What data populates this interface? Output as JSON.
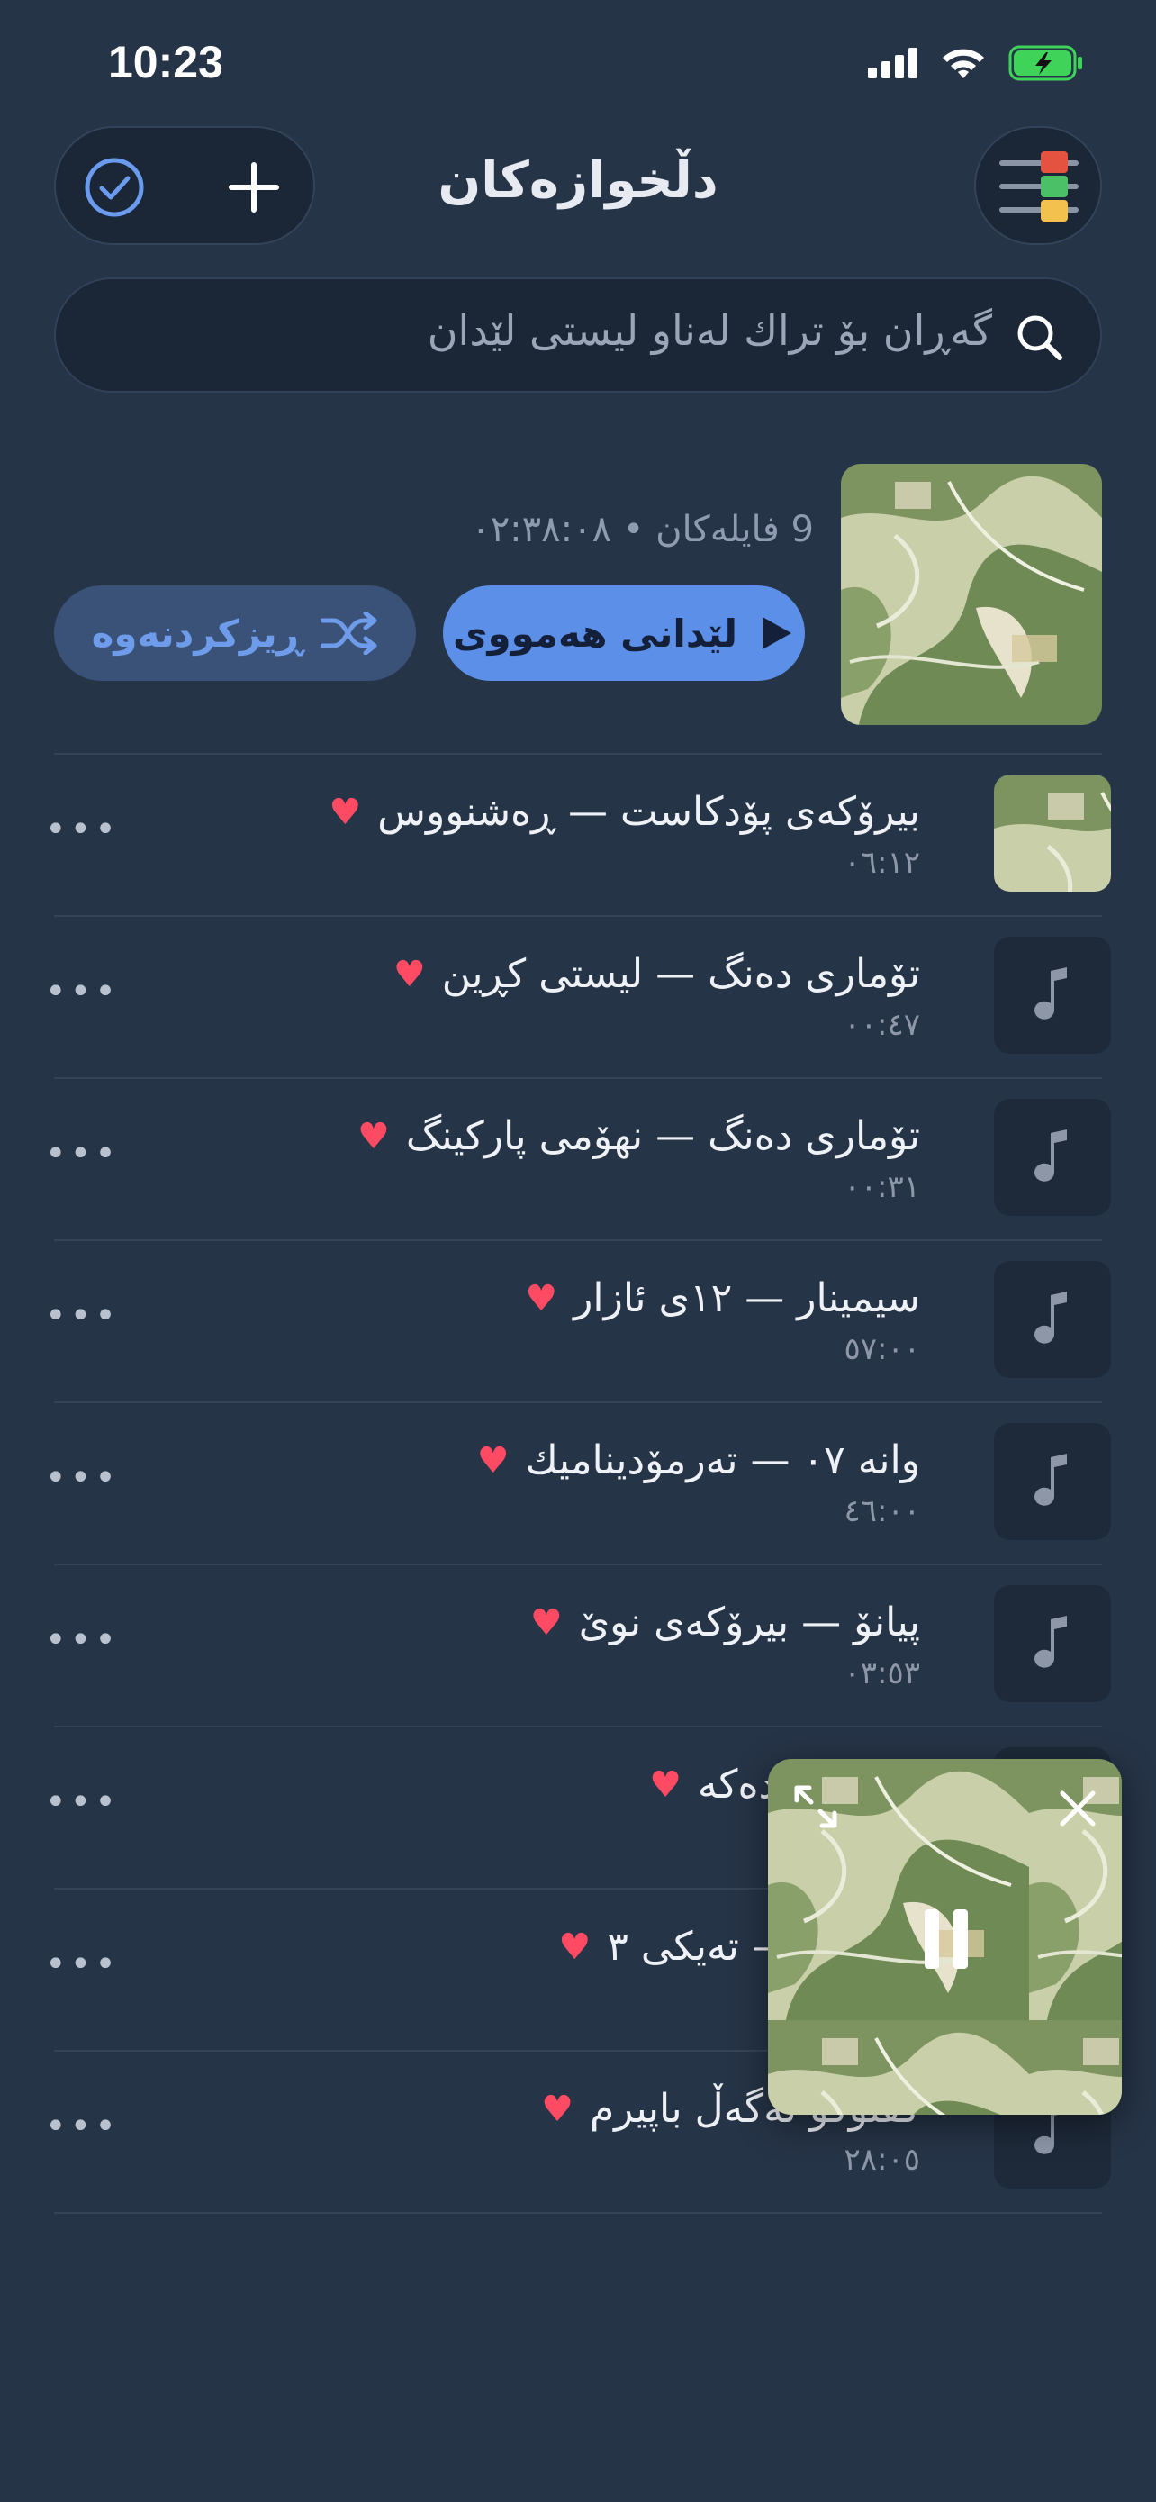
{
  "status": {
    "time": "10:23"
  },
  "header": {
    "title": "دڵخوازەکان"
  },
  "search": {
    "placeholder": "گەڕان بۆ تراك لەناو لیستی لێدان"
  },
  "playlist": {
    "meta": "9 فایلەکان • ٠٢:٣٨:٠٨",
    "play_all": "لێدانی هەمووی",
    "shuffle": "ڕیزکردنەوە"
  },
  "tracks": [
    {
      "title": "بیرۆکەی پۆدکاست — ڕەشنووس",
      "duration": "٠٦:١٢",
      "art": true
    },
    {
      "title": "تۆماری دەنگ — لیستی کڕین",
      "duration": "٠٠:٤٧",
      "art": false
    },
    {
      "title": "تۆماری دەنگ — نهۆمی پارکینگ",
      "duration": "٠٠:٣١",
      "art": false
    },
    {
      "title": "سیمینار — ١٢ی ئازار",
      "duration": "٥٧:٠٠",
      "art": false
    },
    {
      "title": "وانە ٠٧ — تەرمۆدینامیك",
      "duration": "٤٦:٠٠",
      "art": false
    },
    {
      "title": "پیانۆ — بیرۆکەی نوێ",
      "duration": "٠٣:٥٣",
      "art": false
    },
    {
      "title": "بەشی پردەکە",
      "duration": "",
      "art": false
    },
    {
      "title": "گرووپ — تەیکی ٣",
      "duration": "",
      "art": false
    },
    {
      "title": "گفتوگۆ لەگەڵ باپیرم",
      "duration": "٢٨:٠٥",
      "art": false
    }
  ],
  "colors": {
    "accent": "#5c8fe8",
    "heart": "#ff4a63",
    "background": "#263447"
  }
}
